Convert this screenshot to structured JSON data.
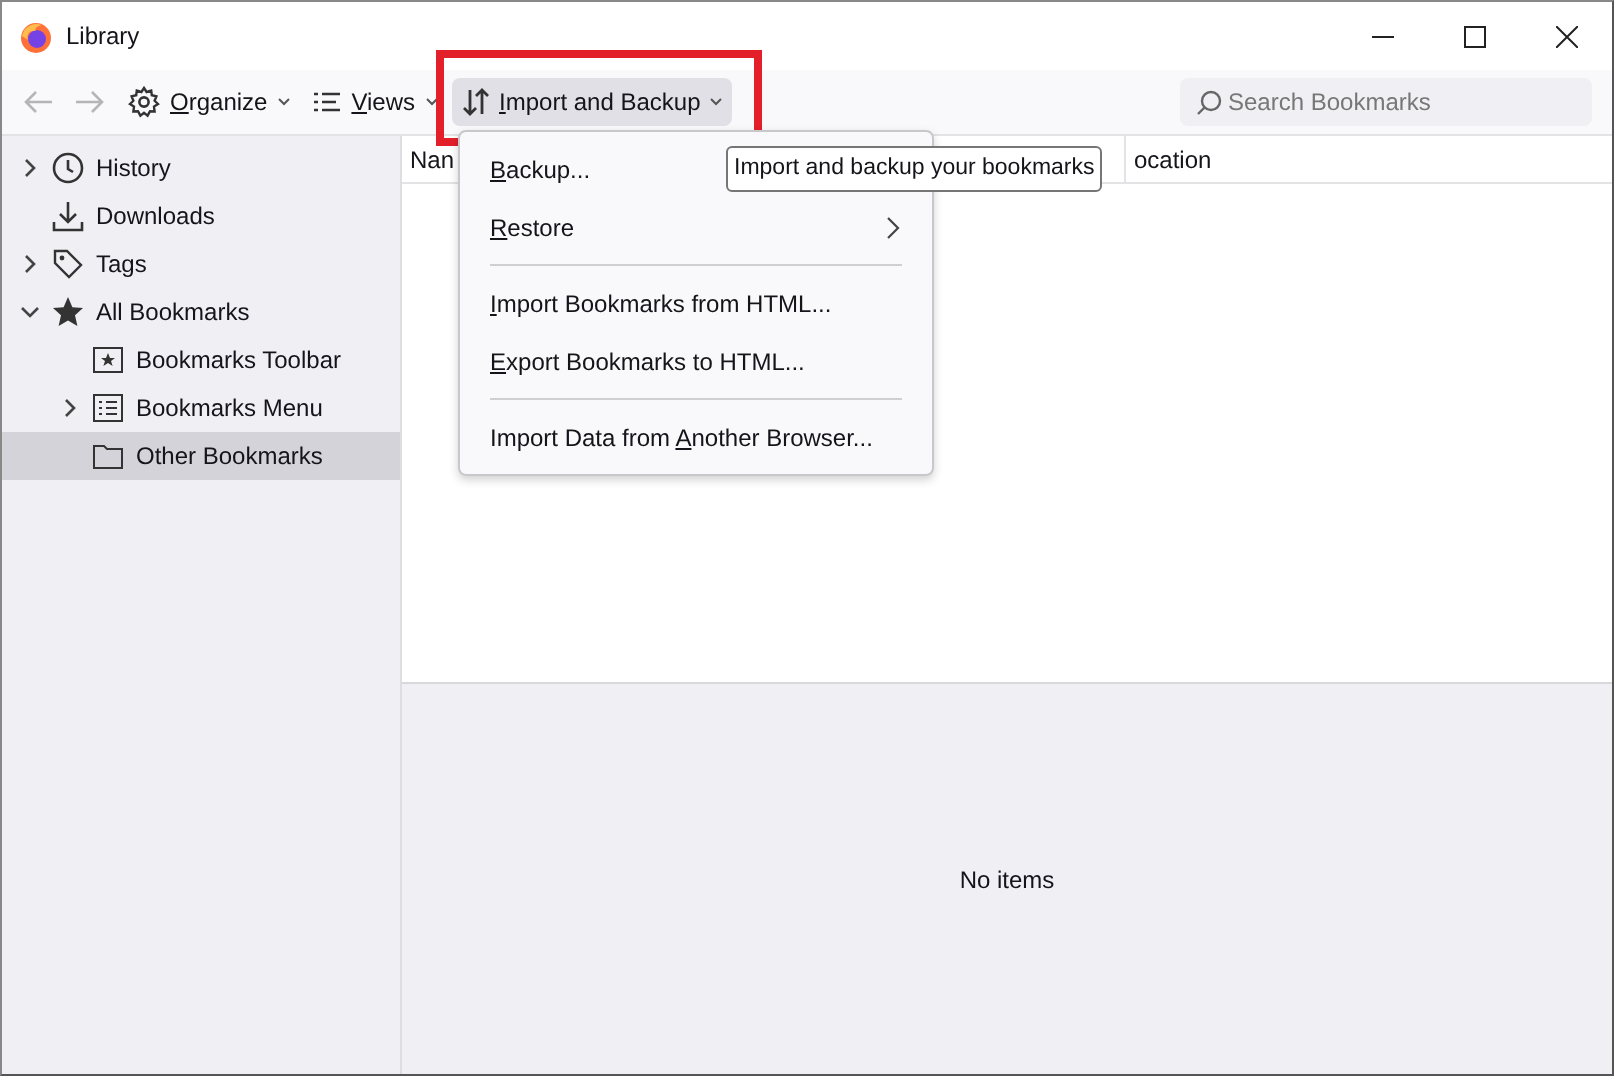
{
  "window": {
    "title": "Library"
  },
  "toolbar": {
    "buttons": [
      {
        "kind": "back",
        "disabled": true
      },
      {
        "kind": "forward",
        "disabled": true
      },
      {
        "kind": "organize",
        "label": {
          "key": "O",
          "post": "rganize"
        },
        "highlighted": false
      },
      {
        "kind": "views",
        "label": {
          "key": "V",
          "post": "iews"
        },
        "highlighted": false
      },
      {
        "kind": "import",
        "label": {
          "key": "I",
          "post": "mport and Backup"
        },
        "highlighted": true
      }
    ],
    "search": {
      "placeholder": "Search Bookmarks"
    }
  },
  "sidebar": {
    "items": [
      {
        "kind": "history",
        "label": "History",
        "expanded": false,
        "selected": false
      },
      {
        "kind": "downloads",
        "label": "Downloads",
        "selected": false
      },
      {
        "kind": "tags",
        "label": "Tags",
        "expanded": false,
        "selected": false
      },
      {
        "kind": "bookmarks",
        "label": "All Bookmarks",
        "expanded": true,
        "selected": false,
        "children": [
          {
            "kind": "toolbar",
            "label": "Bookmarks Toolbar",
            "selected": false
          },
          {
            "kind": "menu",
            "label": "Bookmarks Menu",
            "expanded": false,
            "selected": false
          },
          {
            "kind": "folder",
            "label": "Other Bookmarks",
            "selected": true
          }
        ]
      }
    ]
  },
  "table": {
    "columns": [
      "Nan",
      "ocation"
    ]
  },
  "details": {
    "message": "No items"
  },
  "menu": {
    "items": [
      {
        "kind": "item",
        "label": {
          "key": "B",
          "post": "ackup..."
        }
      },
      {
        "kind": "submenu",
        "label": {
          "key": "R",
          "post": "estore"
        }
      },
      {
        "kind": "separator"
      },
      {
        "kind": "item",
        "label": {
          "key": "I",
          "post": "mport Bookmarks from HTML..."
        }
      },
      {
        "kind": "item",
        "label": {
          "key": "E",
          "post": "xport Bookmarks to HTML..."
        }
      },
      {
        "kind": "separator"
      },
      {
        "kind": "item",
        "label": {
          "pre": "Import Data from ",
          "key": "A",
          "post": "nother Browser..."
        }
      }
    ]
  },
  "tooltip": {
    "text": "Import and backup your bookmarks"
  }
}
